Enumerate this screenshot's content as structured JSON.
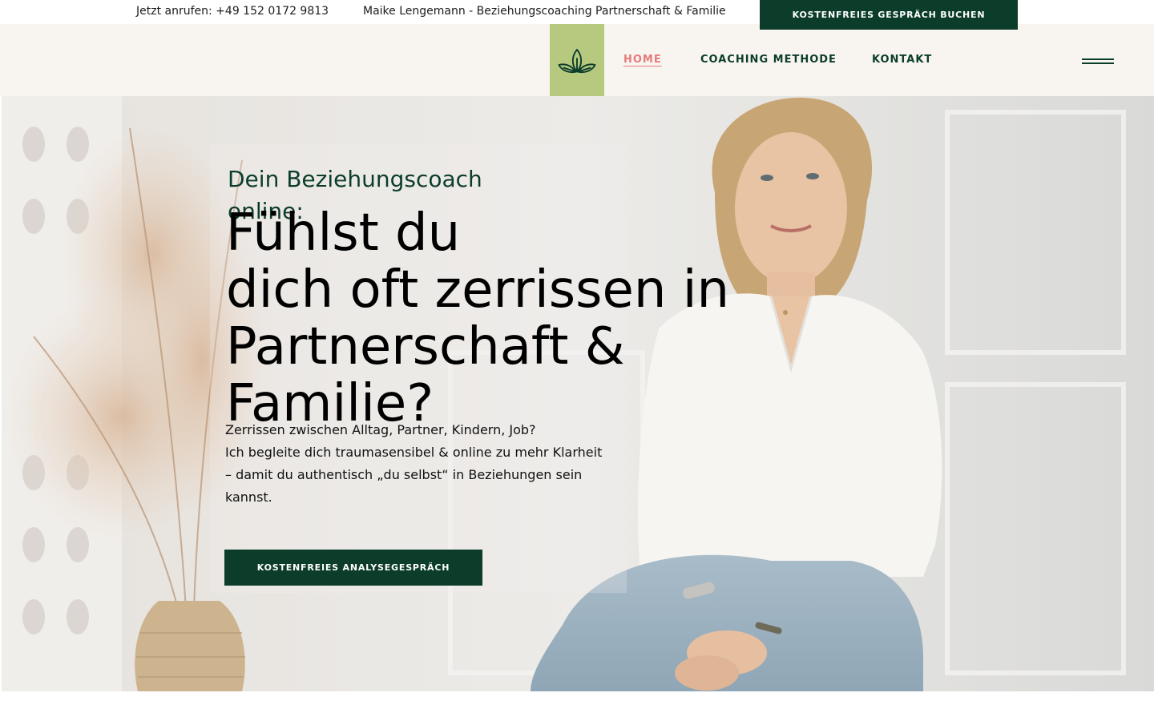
{
  "topbar": {
    "phone": "Jetzt anrufen: +49 152 0172 9813",
    "tagline": "Maike Lengemann - Beziehungscoaching Partnerschaft & Familie",
    "book_button": "KOSTENFREIES GESPRÄCH BUCHEN"
  },
  "nav": {
    "logo_icon": "lotus-leaves-icon",
    "items": [
      {
        "label": "HOME",
        "active": true
      },
      {
        "label": "COACHING METHODE",
        "active": false
      },
      {
        "label": "KONTAKT",
        "active": false
      }
    ],
    "menu_icon": "hamburger-menu-icon"
  },
  "hero": {
    "eyebrow": "Dein Beziehungscoach online:",
    "title_lines": [
      "Fühlst du",
      "dich oft zerrissen in",
      "Partnerschaft &",
      "Familie?"
    ],
    "text_lines": [
      "Zerrissen zwischen Alltag, Partner, Kindern, Job?",
      "Ich begleite dich traumasensibel & online zu mehr Klarheit",
      "– damit du authentisch „du selbst“ in Beziehungen sein",
      "kannst."
    ],
    "cta": "KOSTENFREIES ANALYSEGESPRÄCH"
  },
  "colors": {
    "brand_green": "#0c3d2b",
    "logo_green": "#b6c97e",
    "active_link": "#e77b7b",
    "header_bg": "#f8f5f1"
  }
}
